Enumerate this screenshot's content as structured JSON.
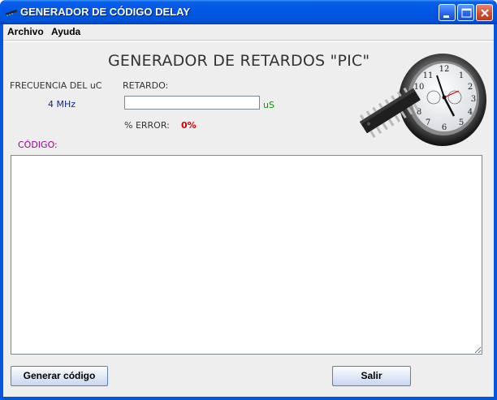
{
  "window": {
    "title": "GENERADOR DE CÓDIGO DELAY",
    "controls": [
      "minimize-icon",
      "maximize-icon",
      "close-icon"
    ]
  },
  "menu": {
    "items": [
      {
        "label": "Archivo"
      },
      {
        "label": "Ayuda"
      }
    ]
  },
  "main": {
    "heading": "GENERADOR DE RETARDOS \"PIC\"",
    "frequency": {
      "label": "FRECUENCIA DEL uC",
      "value": "4 MHz"
    },
    "delay": {
      "label": "RETARDO:",
      "input_value": "",
      "unit": "uS"
    },
    "error": {
      "label": "% ERROR:",
      "value": "0%"
    },
    "code": {
      "label": "CÓDIGO:",
      "content": ""
    },
    "illustration": "pic-chip-and-clock-icon"
  },
  "buttons": {
    "generate_label": "Generar código",
    "exit_label": "Salir"
  },
  "colors": {
    "titlebar": "#0058e6",
    "frequency_value": "#0a2a8c",
    "unit": "#009900",
    "error_value": "#cc0000",
    "code_label": "#990099"
  }
}
